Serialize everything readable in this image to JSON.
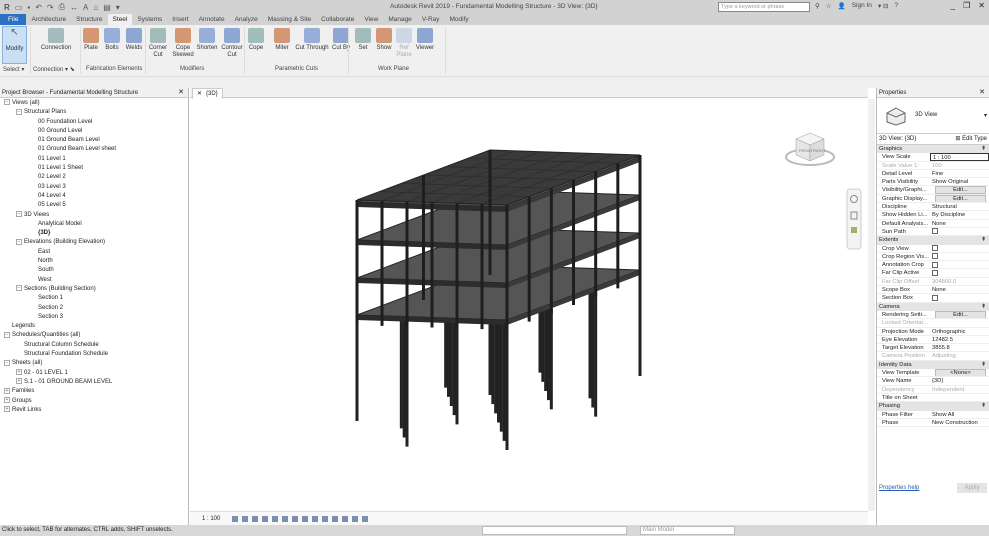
{
  "title_bar": {
    "app_title": "Autodesk Revit 2019 - Fundamental Modelling Structure - 3D View: {3D}",
    "search_placeholder": "Type a keyword or phrase",
    "sign_in": "Sign In"
  },
  "ribbon_tabs": [
    "File",
    "Architecture",
    "Structure",
    "Steel",
    "Systems",
    "Insert",
    "Annotate",
    "Analyze",
    "Massing & Site",
    "Collaborate",
    "View",
    "Manage",
    "V-Ray",
    "Modify"
  ],
  "active_tab": "Steel",
  "ribbon": {
    "buttons": [
      {
        "label": "Modify",
        "icon": "cursor-icon"
      },
      {
        "label": "Connection",
        "icon": "connection-icon"
      },
      {
        "label": "Plate",
        "icon": "plate-icon"
      },
      {
        "label": "Bolts",
        "icon": "bolts-icon"
      },
      {
        "label": "Welds",
        "icon": "welds-icon"
      },
      {
        "label": "Corner Cut",
        "icon": "corner-cut-icon"
      },
      {
        "label": "Cope Skewed",
        "icon": "cope-skewed-icon"
      },
      {
        "label": "Shorten",
        "icon": "shorten-icon"
      },
      {
        "label": "Contour Cut",
        "icon": "contour-cut-icon"
      },
      {
        "label": "Cope",
        "icon": "cope-icon"
      },
      {
        "label": "Miter",
        "icon": "miter-icon"
      },
      {
        "label": "Cut Through",
        "icon": "cut-through-icon"
      },
      {
        "label": "Cut By",
        "icon": "cut-by-icon"
      },
      {
        "label": "Set",
        "icon": "set-icon"
      },
      {
        "label": "Show",
        "icon": "show-icon"
      },
      {
        "label": "Ref Plane",
        "icon": "ref-plane-icon"
      },
      {
        "label": "Viewer",
        "icon": "viewer-icon"
      }
    ],
    "panels": [
      "Select ▾",
      "Connection ▾ ⬊",
      "Fabrication Elements",
      "Modifiers",
      "Parametric Cuts",
      "Work Plane"
    ]
  },
  "project_browser": {
    "title": "Project Browser - Fundamental Modelling Structure",
    "items": [
      {
        "label": "Views (all)",
        "level": 0,
        "toggle": "−"
      },
      {
        "label": "Structural Plans",
        "level": 1,
        "toggle": "−"
      },
      {
        "label": "00 Foundation Level",
        "level": 2
      },
      {
        "label": "00 Ground Level",
        "level": 2
      },
      {
        "label": "01 Ground Beam Level",
        "level": 2
      },
      {
        "label": "01 Ground Beam Level sheet",
        "level": 2
      },
      {
        "label": "01 Level 1",
        "level": 2
      },
      {
        "label": "01 Level 1 Sheet",
        "level": 2
      },
      {
        "label": "02 Level 2",
        "level": 2
      },
      {
        "label": "03 Level 3",
        "level": 2
      },
      {
        "label": "04 Level 4",
        "level": 2
      },
      {
        "label": "05 Level 5",
        "level": 2
      },
      {
        "label": "3D Views",
        "level": 1,
        "toggle": "−"
      },
      {
        "label": "Analytical Model",
        "level": 2
      },
      {
        "label": "{3D}",
        "level": 2,
        "bold": true
      },
      {
        "label": "Elevations (Building Elevation)",
        "level": 1,
        "toggle": "−"
      },
      {
        "label": "East",
        "level": 2
      },
      {
        "label": "North",
        "level": 2
      },
      {
        "label": "South",
        "level": 2
      },
      {
        "label": "West",
        "level": 2
      },
      {
        "label": "Sections (Building Section)",
        "level": 1,
        "toggle": "−"
      },
      {
        "label": "Section 1",
        "level": 2
      },
      {
        "label": "Section 2",
        "level": 2
      },
      {
        "label": "Section 3",
        "level": 2
      },
      {
        "label": "Legends",
        "level": 0
      },
      {
        "label": "Schedules/Quantities (all)",
        "level": 0,
        "toggle": "−"
      },
      {
        "label": "Structural Column Schedule",
        "level": 1
      },
      {
        "label": "Structural Foundation Schedule",
        "level": 1
      },
      {
        "label": "Sheets (all)",
        "level": 0,
        "toggle": "−"
      },
      {
        "label": "02 - 01 LEVEL 1",
        "level": 1,
        "toggle": "+"
      },
      {
        "label": "S.1 - 01 GROUND BEAM LEVEL",
        "level": 1,
        "toggle": "+"
      },
      {
        "label": "Families",
        "level": 0,
        "toggle": "+"
      },
      {
        "label": "Groups",
        "level": 0,
        "toggle": "+"
      },
      {
        "label": "Revit Links",
        "level": 0,
        "toggle": "+"
      }
    ]
  },
  "view_tab": {
    "label": "{3D}"
  },
  "viewcube": {
    "faces": [
      "TOP",
      "FRONT",
      "RIGHT"
    ]
  },
  "view_control_bar": {
    "scale": "1 : 100"
  },
  "properties": {
    "title": "Properties",
    "type_name": "3D View",
    "filter": "3D View: {3D}",
    "edit_type": "Edit Type",
    "groups": [
      {
        "name": "Graphics",
        "rows": [
          {
            "k": "View Scale",
            "v": "1 : 100",
            "input": true
          },
          {
            "k": "Scale Value 1:",
            "v": "100",
            "disabled": true
          },
          {
            "k": "Detail Level",
            "v": "Fine"
          },
          {
            "k": "Parts Visibility",
            "v": "Show Original"
          },
          {
            "k": "Visibility/Graphi...",
            "v": "Edit...",
            "button": true
          },
          {
            "k": "Graphic Display...",
            "v": "Edit...",
            "button": true
          },
          {
            "k": "Discipline",
            "v": "Structural"
          },
          {
            "k": "Show Hidden Li...",
            "v": "By Discipline"
          },
          {
            "k": "Default Analysis...",
            "v": "None"
          },
          {
            "k": "Sun Path",
            "checkbox": true
          }
        ]
      },
      {
        "name": "Extents",
        "rows": [
          {
            "k": "Crop View",
            "checkbox": true
          },
          {
            "k": "Crop Region Vis...",
            "checkbox": true
          },
          {
            "k": "Annotation Crop",
            "checkbox": true
          },
          {
            "k": "Far Clip Active",
            "checkbox": true
          },
          {
            "k": "Far Clip Offset",
            "v": "304800.0",
            "disabled": true
          },
          {
            "k": "Scope Box",
            "v": "None"
          },
          {
            "k": "Section Box",
            "checkbox": true
          }
        ]
      },
      {
        "name": "Camera",
        "rows": [
          {
            "k": "Rendering Setti...",
            "v": "Edit...",
            "button": true
          },
          {
            "k": "Locked Orientat...",
            "v": "",
            "disabled": true
          },
          {
            "k": "Projection Mode",
            "v": "Orthographic"
          },
          {
            "k": "Eye Elevation",
            "v": "12482.5"
          },
          {
            "k": "Target Elevation",
            "v": "3855.8"
          },
          {
            "k": "Camera Position",
            "v": "Adjusting",
            "disabled": true
          }
        ]
      },
      {
        "name": "Identity Data",
        "rows": [
          {
            "k": "View Template",
            "v": "<None>",
            "button": true
          },
          {
            "k": "View Name",
            "v": "{3D}"
          },
          {
            "k": "Dependency",
            "v": "Independent",
            "disabled": true
          },
          {
            "k": "Title on Sheet",
            "v": ""
          }
        ]
      },
      {
        "name": "Phasing",
        "rows": [
          {
            "k": "Phase Filter",
            "v": "Show All"
          },
          {
            "k": "Phase",
            "v": "New Construction"
          }
        ]
      }
    ],
    "help_link": "Properties help",
    "apply": "Apply"
  },
  "status_bar": {
    "message": "Click to select, TAB for alternates, CTRL adds, SHIFT unselects.",
    "workset": "",
    "model": "Main Model"
  },
  "colors": {
    "accent": "#2c71c2",
    "model": "#3a3a3a",
    "panel_bg": "#f0f0f0"
  }
}
